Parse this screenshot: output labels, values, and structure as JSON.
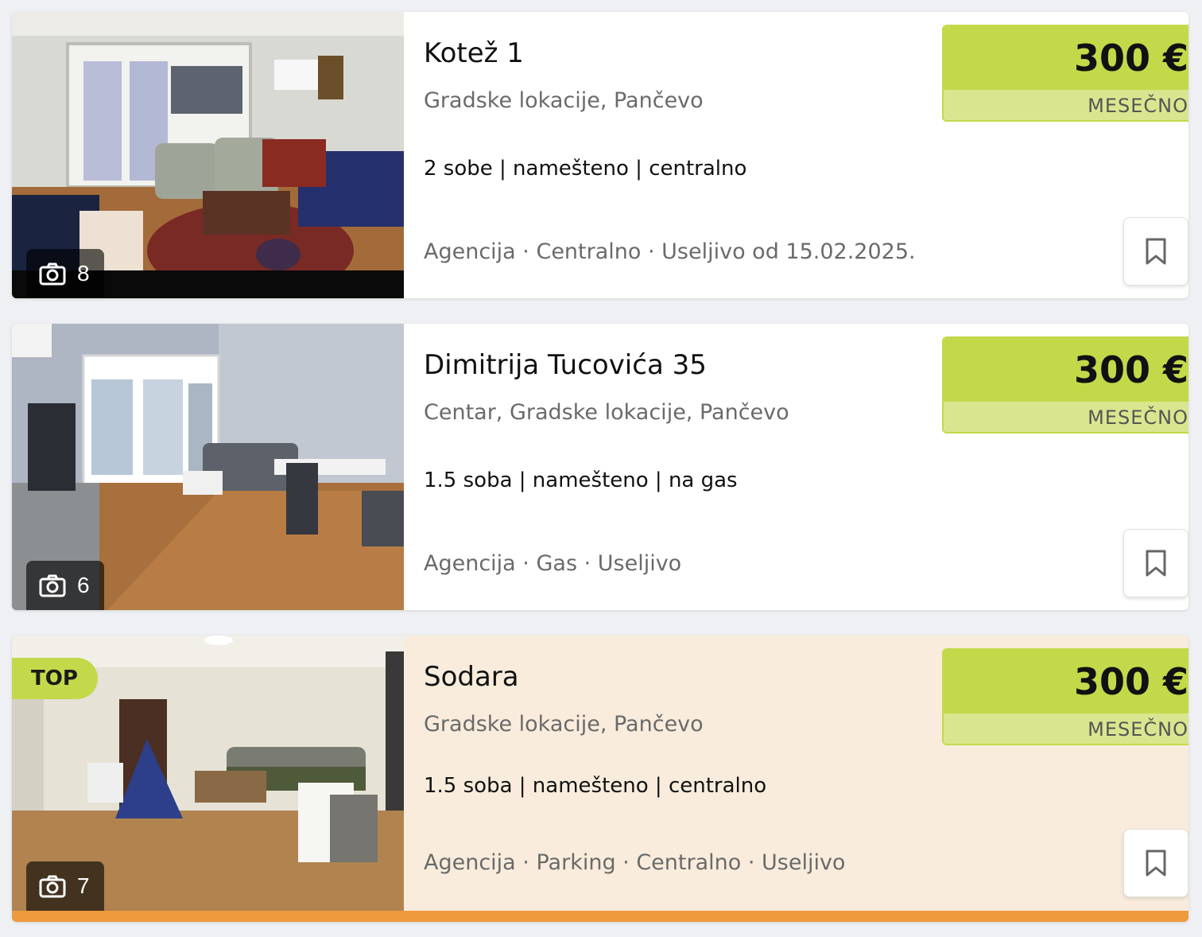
{
  "listings": [
    {
      "title": "Kotež 1",
      "location": "Gradske lokacije, Pančevo",
      "features": "2 sobe | namešteno | centralno",
      "meta": "Agencija · Centralno · Useljivo od 15.02.2025.",
      "price": "300 €",
      "period": "MESEČNO",
      "photo_count": "8",
      "camera_icon": "camera-icon",
      "save_icon": "bookmark-icon"
    },
    {
      "title": "Dimitrija Tucovića 35",
      "location": "Centar, Gradske lokacije, Pančevo",
      "features": "1.5 soba | namešteno | na gas",
      "meta": "Agencija · Gas · Useljivo",
      "price": "300 €",
      "period": "MESEČNO",
      "photo_count": "6",
      "camera_icon": "camera-icon",
      "save_icon": "bookmark-icon"
    },
    {
      "badge": "TOP",
      "title": "Sodara",
      "location": "Gradske lokacije, Pančevo",
      "features": "1.5 soba | namešteno | centralno",
      "meta": "Agencija · Parking · Centralno · Useljivo",
      "price": "300 €",
      "period": "MESEČNO",
      "photo_count": "7",
      "camera_icon": "camera-icon",
      "save_icon": "bookmark-icon"
    }
  ],
  "colors": {
    "price_bg": "#c3d94a",
    "price_period_bg": "#dae68f",
    "top_card_bg": "#f9ecdc",
    "top_card_accent": "#ef9a3d"
  }
}
